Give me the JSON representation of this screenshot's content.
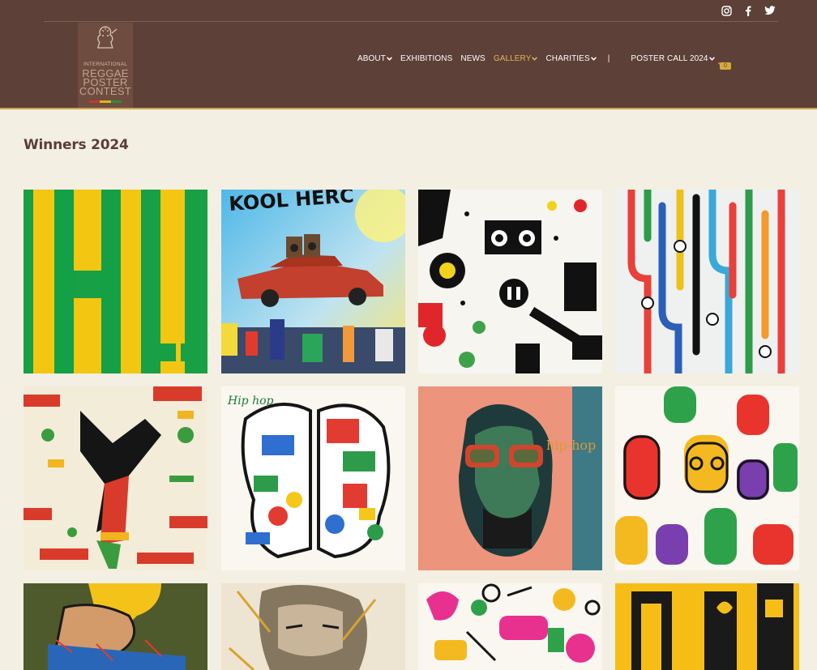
{
  "header": {
    "logo": {
      "alt": "International Reggae Poster Contest",
      "line1": "INTERNATIONAL",
      "line2": "REGGAE",
      "line3": "POSTER",
      "line4": "CONTEST"
    },
    "social": [
      "instagram-icon",
      "facebook-icon",
      "twitter-icon"
    ],
    "nav": [
      {
        "label": "ABOUT",
        "dropdown": true,
        "active": false
      },
      {
        "label": "EXHIBITIONS",
        "dropdown": false,
        "active": false
      },
      {
        "label": "NEWS",
        "dropdown": false,
        "active": false
      },
      {
        "label": "GALLERY",
        "dropdown": true,
        "active": true
      },
      {
        "label": "CHARITIES",
        "dropdown": true,
        "active": false
      },
      {
        "label": "POSTER CALL 2024",
        "dropdown": true,
        "active": false
      }
    ],
    "separator": "|",
    "cart_count": "0"
  },
  "main": {
    "title": "Winners 2024",
    "posters": [
      {
        "text": "",
        "kind": "stripes"
      },
      {
        "text": "KOOL HERC",
        "kind": "car"
      },
      {
        "text": "",
        "kind": "boombox"
      },
      {
        "text": "",
        "kind": "tubes"
      },
      {
        "text": "",
        "kind": "breakdance"
      },
      {
        "text": "Hip hop",
        "kind": "doodle"
      },
      {
        "text": "hip-hop",
        "kind": "portrait"
      },
      {
        "text": "",
        "kind": "faces"
      },
      {
        "text": "",
        "kind": "olive"
      },
      {
        "text": "",
        "kind": "sketch"
      },
      {
        "text": "",
        "kind": "instruments"
      },
      {
        "text": "",
        "kind": "yellow"
      }
    ]
  },
  "colors": {
    "header_bg": "#5d4037",
    "page_bg": "#f3efe2",
    "accent": "#e0b45a"
  }
}
